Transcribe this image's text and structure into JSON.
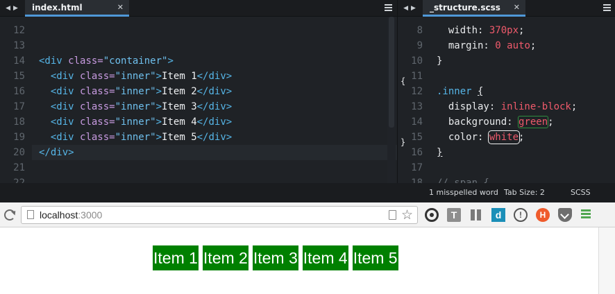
{
  "editor": {
    "left_tab": {
      "title": "index.html",
      "close": "✕"
    },
    "right_tab": {
      "title": "_structure.scss",
      "close": "✕"
    },
    "nav": {
      "back": "◀",
      "forward": "▶"
    },
    "left_code": {
      "line_numbers": [
        "12",
        "13",
        "14",
        "15",
        "16",
        "17",
        "18",
        "19",
        "20",
        "21",
        "22"
      ],
      "lines": [
        [],
        [],
        [
          {
            "c": "t-tag",
            "t": "<div "
          },
          {
            "c": "t-attr",
            "t": "class="
          },
          {
            "c": "t-str",
            "t": "\"container\""
          },
          {
            "c": "t-tag",
            "t": ">"
          }
        ],
        [
          {
            "c": "t-txt",
            "t": "  "
          },
          {
            "c": "t-tag",
            "t": "<div "
          },
          {
            "c": "t-attr",
            "t": "class="
          },
          {
            "c": "t-str",
            "t": "\"inner\""
          },
          {
            "c": "t-tag",
            "t": ">"
          },
          {
            "c": "t-txt",
            "t": "Item 1"
          },
          {
            "c": "t-tag",
            "t": "</div>"
          }
        ],
        [
          {
            "c": "t-txt",
            "t": "  "
          },
          {
            "c": "t-tag",
            "t": "<div "
          },
          {
            "c": "t-attr",
            "t": "class="
          },
          {
            "c": "t-str",
            "t": "\"inner\""
          },
          {
            "c": "t-tag",
            "t": ">"
          },
          {
            "c": "t-txt",
            "t": "Item 2"
          },
          {
            "c": "t-tag",
            "t": "</div>"
          }
        ],
        [
          {
            "c": "t-txt",
            "t": "  "
          },
          {
            "c": "t-tag",
            "t": "<div "
          },
          {
            "c": "t-attr",
            "t": "class="
          },
          {
            "c": "t-str",
            "t": "\"inner\""
          },
          {
            "c": "t-tag",
            "t": ">"
          },
          {
            "c": "t-txt",
            "t": "Item 3"
          },
          {
            "c": "t-tag",
            "t": "</div>"
          }
        ],
        [
          {
            "c": "t-txt",
            "t": "  "
          },
          {
            "c": "t-tag",
            "t": "<div "
          },
          {
            "c": "t-attr",
            "t": "class="
          },
          {
            "c": "t-str",
            "t": "\"inner\""
          },
          {
            "c": "t-tag",
            "t": ">"
          },
          {
            "c": "t-txt",
            "t": "Item 4"
          },
          {
            "c": "t-tag",
            "t": "</div>"
          }
        ],
        [
          {
            "c": "t-txt",
            "t": "  "
          },
          {
            "c": "t-tag",
            "t": "<div "
          },
          {
            "c": "t-attr",
            "t": "class="
          },
          {
            "c": "t-str",
            "t": "\"inner\""
          },
          {
            "c": "t-tag",
            "t": ">"
          },
          {
            "c": "t-txt",
            "t": "Item 5"
          },
          {
            "c": "t-tag",
            "t": "</div>"
          }
        ],
        [
          {
            "c": "t-tag",
            "t": "</div>"
          }
        ],
        [],
        []
      ]
    },
    "right_code": {
      "line_numbers": [
        "8",
        "9",
        "10",
        "11",
        "12",
        "13",
        "14",
        "15",
        "16",
        "17",
        "18"
      ],
      "lines": [
        [
          {
            "c": "t-prop",
            "t": "  width: "
          },
          {
            "c": "t-num",
            "t": "370px"
          },
          {
            "c": "t-prop",
            "t": ";"
          }
        ],
        [
          {
            "c": "t-prop",
            "t": "  margin: "
          },
          {
            "c": "t-num",
            "t": "0 auto"
          },
          {
            "c": "t-prop",
            "t": ";"
          }
        ],
        [
          {
            "c": "t-prop",
            "t": "}"
          }
        ],
        [],
        [
          {
            "c": "t-sel",
            "t": ".inner "
          },
          {
            "c": "t-prop u",
            "t": "{"
          }
        ],
        [
          {
            "c": "t-prop",
            "t": "  display: "
          },
          {
            "c": "t-val",
            "t": "inline-block"
          },
          {
            "c": "t-prop",
            "t": ";"
          }
        ],
        [
          {
            "c": "t-prop",
            "t": "  background: "
          },
          {
            "c": "t-val spell-green",
            "t": "green"
          },
          {
            "c": "t-prop",
            "t": ";"
          }
        ],
        [
          {
            "c": "t-prop",
            "t": "  color: "
          },
          {
            "c": "t-val spell-white",
            "t": "white"
          },
          {
            "c": "t-prop",
            "t": ";"
          }
        ],
        [
          {
            "c": "t-prop u",
            "t": "}"
          }
        ],
        [],
        [
          {
            "c": "t-comment",
            "t": "// span {"
          }
        ]
      ],
      "brace_open": "{",
      "brace_close": "}"
    },
    "status": {
      "spelling": "1 misspelled word",
      "tab_size": "Tab Size: 2",
      "syntax": "SCSS"
    }
  },
  "browser": {
    "url_host": "localhost",
    "url_port": ":3000",
    "star": "☆",
    "ext_t": "T",
    "ext_d": "d",
    "ext_info": "!",
    "ext_h": "H",
    "items": [
      "Item 1",
      "Item 2",
      "Item 3",
      "Item 4",
      "Item 5"
    ]
  },
  "colors": {
    "item_bg": "#008000",
    "tab_underline": "#4f98d8",
    "editor_bg": "#1f2226"
  }
}
